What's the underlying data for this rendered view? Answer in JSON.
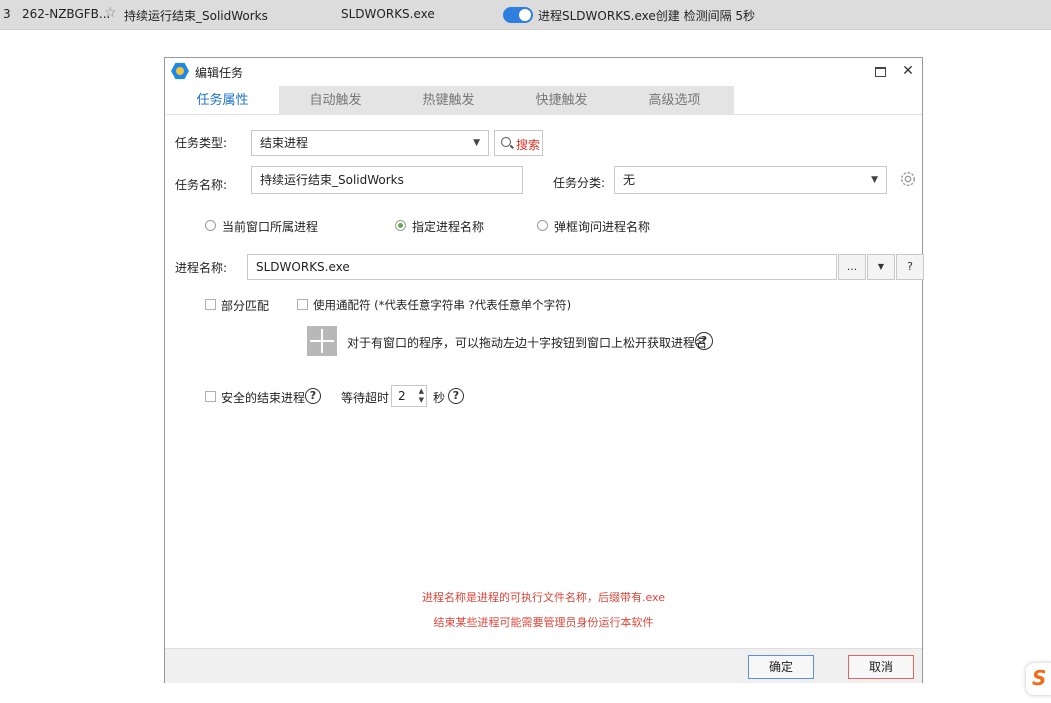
{
  "topbar": {
    "row_index": "3",
    "device_id": "262-NZBGFB...",
    "task_name": "持续运行结束_SolidWorks",
    "process": "SLDWORKS.exe",
    "trigger": "进程SLDWORKS.exe创建 检测间隔 5秒",
    "toggle_on": true
  },
  "dialog": {
    "title": "编辑任务",
    "tabs": [
      {
        "label": "任务属性",
        "active": true
      },
      {
        "label": "自动触发",
        "active": false
      },
      {
        "label": "热键触发",
        "active": false
      },
      {
        "label": "快捷触发",
        "active": false
      },
      {
        "label": "高级选项",
        "active": false
      }
    ],
    "task_type_label": "任务类型:",
    "task_type_value": "结束进程",
    "search_label": "搜索",
    "task_name_label": "任务名称:",
    "task_name_value": "持续运行结束_SolidWorks",
    "category_label": "任务分类:",
    "category_value": "无",
    "radios": [
      {
        "label": "当前窗口所属进程",
        "checked": false
      },
      {
        "label": "指定进程名称",
        "checked": true
      },
      {
        "label": "弹框询问进程名称",
        "checked": false
      }
    ],
    "process_name_label": "进程名称:",
    "process_name_value": "SLDWORKS.exe",
    "side_buttons": [
      "...",
      "▼",
      "?"
    ],
    "partial_match_label": "部分匹配",
    "wildcard_label": "使用通配符 (*代表任意字符串 ?代表任意单个字符)",
    "drag_hint": "对于有窗口的程序，可以拖动左边十字按钮到窗口上松开获取进程名",
    "safe_kill_label": "安全的结束进程",
    "wait_timeout_label": "等待超时",
    "wait_timeout_value": "2",
    "seconds_label": "秒",
    "note_lines": [
      "进程名称是进程的可执行文件名称，后缀带有.exe",
      "结束某些进程可能需要管理员身份运行本软件"
    ],
    "ok_label": "确定",
    "cancel_label": "取消"
  },
  "colors": {
    "accent": "#1a73c9",
    "note": "#e0453a",
    "toggle": "#2f7fe0"
  }
}
